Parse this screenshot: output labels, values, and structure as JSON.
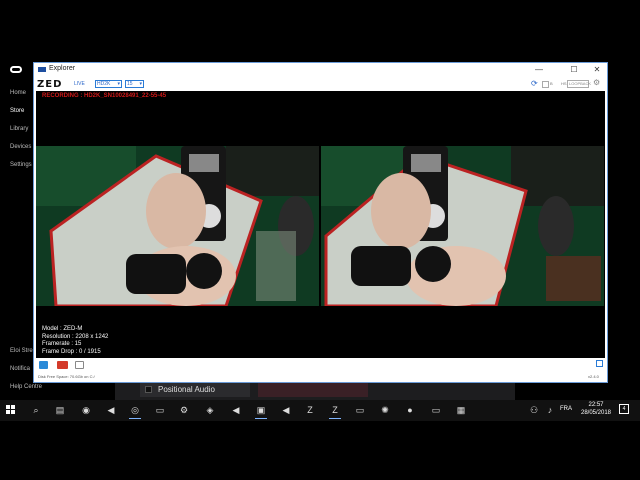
{
  "oculus": {
    "nav": [
      "Home",
      "Store",
      "Library",
      "Devices",
      "Settings"
    ],
    "active": "Store",
    "bottom_nav": [
      "Eloi Stre",
      "Notifica",
      "Help Centre"
    ],
    "tile_label": "Positional Audio"
  },
  "window": {
    "title": "Explorer",
    "controls": {
      "minimize": "—",
      "maximize": "☐",
      "close": "✕"
    }
  },
  "toolbar": {
    "logo": "ZED",
    "live_label": "LIVE",
    "resolution": "HD2K",
    "fps": "15",
    "checkbox_label": "B",
    "field_label": "HS",
    "field_value": "LOOPBACK",
    "gear": "⚙",
    "refresh": "⟳"
  },
  "viewer": {
    "recording_text": "RECORDING : HD2K_SN10028491_22-55-45",
    "info": {
      "model": "Model : ZED-M",
      "resolution": "Resolution : 2208 x 1242",
      "framerate": "Framerate : 15",
      "frame_drop": "Frame Drop : 0 / 1915"
    }
  },
  "statusbar": {
    "disk_space": "Disk Free Space: 70.6Gb on C:/",
    "version": "v2.4.0"
  },
  "taskbar": {
    "language": "FRA",
    "time": "22:57",
    "date": "28/05/2018",
    "notification_count": "4"
  },
  "colors": {
    "accent": "#2a66c9",
    "recording": "#d01818",
    "taskbar": "#111111"
  }
}
